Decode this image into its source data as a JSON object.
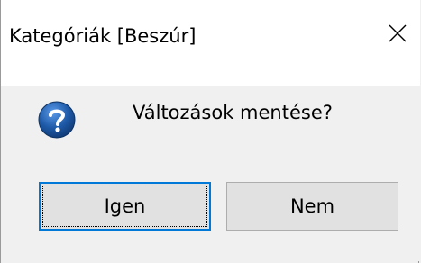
{
  "window": {
    "title": "Kategóriák [Beszúr]",
    "close_icon": "close-icon"
  },
  "dialog": {
    "icon": "question-icon",
    "message": "Változások mentése?"
  },
  "buttons": {
    "yes_label": "Igen",
    "no_label": "Nem"
  },
  "colors": {
    "titlebar": "#ffffff",
    "body": "#f0f0f0",
    "button_face": "#e1e1e1",
    "default_button_border": "#0078d7",
    "icon_blue": "#1e5aa8"
  }
}
